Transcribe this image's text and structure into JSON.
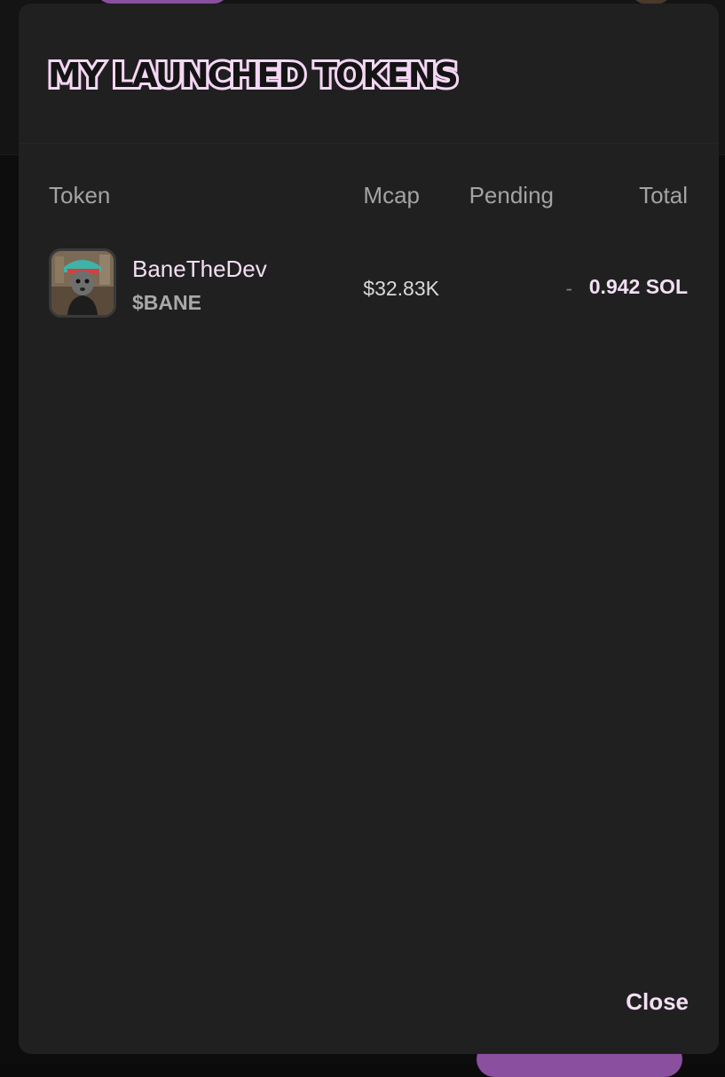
{
  "modal": {
    "title": "MY LAUNCHED TOKENS",
    "close_label": "Close"
  },
  "table": {
    "columns": [
      "Token",
      "Mcap",
      "Pending",
      "Total"
    ],
    "rows": [
      {
        "name": "BaneTheDev",
        "symbol": "$BANE",
        "mcap": "$32.83K",
        "pending": "-",
        "total": "0.942 SOL"
      }
    ]
  },
  "colors": {
    "accent_pink": "#f3dff3",
    "modal_bg": "#202020",
    "backdrop_bg": "#0d0d0d",
    "brand_purple": "#8a4f9e"
  },
  "icons": {
    "token_avatar": "token-avatar-image"
  }
}
